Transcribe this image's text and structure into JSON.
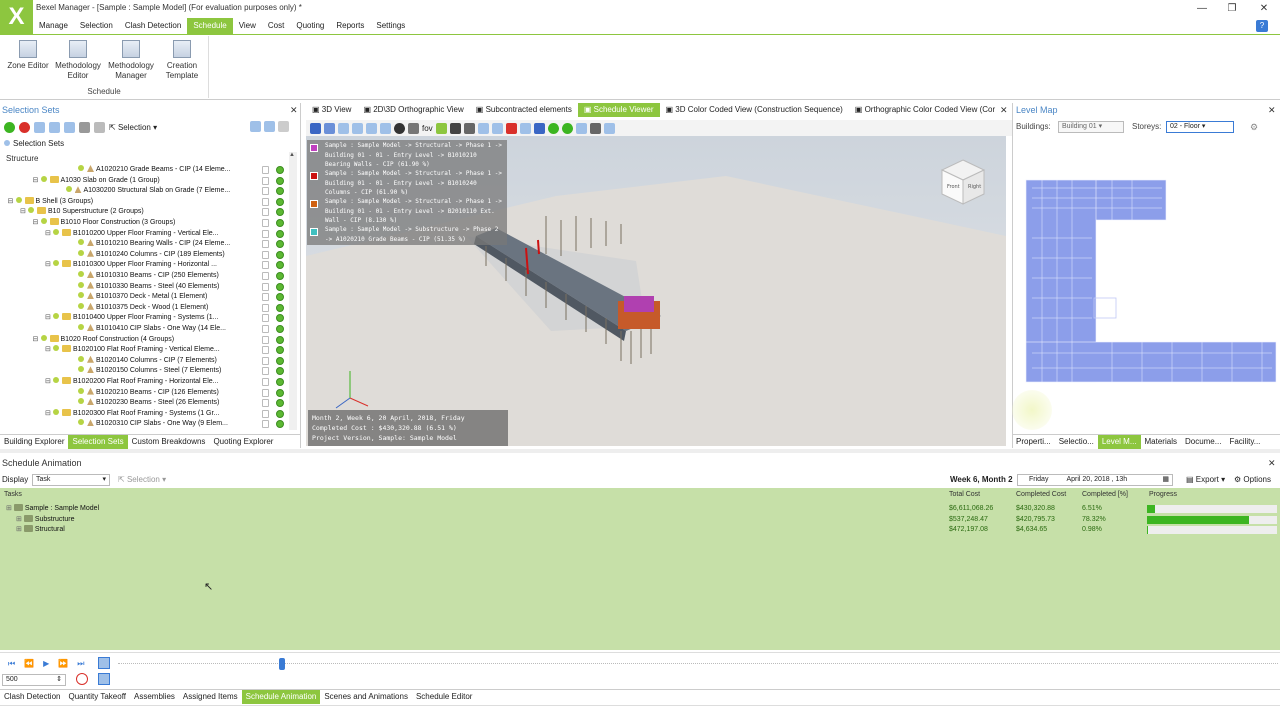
{
  "app": {
    "title": "Bexel Manager - [Sample : Sample Model] (For evaluation purposes only) *",
    "logo": "X",
    "window_buttons": [
      "—",
      "❐",
      "✕"
    ],
    "help_icon": "?"
  },
  "menu": [
    "Manage",
    "Selection",
    "Clash Detection",
    "Schedule",
    "View",
    "Cost",
    "Quoting",
    "Reports",
    "Settings"
  ],
  "menu_active": "Schedule",
  "ribbon": {
    "buttons": [
      {
        "label": "Zone Editor"
      },
      {
        "label": "Methodology Editor"
      },
      {
        "label": "Methodology Manager"
      },
      {
        "label": "Creation Template"
      }
    ],
    "group_label": "Schedule"
  },
  "selection_sets": {
    "title": "Selection Sets",
    "toolbar_selection": "Selection",
    "node_label": "Selection Sets",
    "structure_label": "Structure",
    "tree": [
      {
        "indent": 8,
        "type": "leaf",
        "text": "A1020210 Grade Beams - CIP (14 Eleme..."
      },
      {
        "indent": 5,
        "type": "folder",
        "text": "A1030 Slab on Grade (1 Group)",
        "exp": "⊟"
      },
      {
        "indent": 7,
        "type": "leaf",
        "text": "A1030200 Structural Slab on Grade (7 Eleme..."
      },
      {
        "indent": 3,
        "type": "folder",
        "text": "B Shell (3 Groups)",
        "exp": "⊟"
      },
      {
        "indent": 4,
        "type": "folder",
        "text": "B10 Superstructure (2 Groups)",
        "exp": "⊟"
      },
      {
        "indent": 5,
        "type": "folder",
        "text": "B1010 Floor Construction (3 Groups)",
        "exp": "⊟"
      },
      {
        "indent": 6,
        "type": "folder",
        "text": "B1010200 Upper Floor Framing - Vertical Ele...",
        "exp": "⊟"
      },
      {
        "indent": 8,
        "type": "leaf",
        "text": "B1010210 Bearing Walls - CIP (24 Eleme..."
      },
      {
        "indent": 8,
        "type": "leaf",
        "text": "B1010240 Columns - CIP (189 Elements)"
      },
      {
        "indent": 6,
        "type": "folder",
        "text": "B1010300 Upper Floor Framing - Horizontal ...",
        "exp": "⊟"
      },
      {
        "indent": 8,
        "type": "leaf",
        "text": "B1010310 Beams - CIP (250 Elements)"
      },
      {
        "indent": 8,
        "type": "leaf",
        "text": "B1010330 Beams - Steel (40 Elements)"
      },
      {
        "indent": 8,
        "type": "leaf",
        "text": "B1010370 Deck - Metal (1 Element)"
      },
      {
        "indent": 8,
        "type": "leaf",
        "text": "B1010375 Deck - Wood (1 Element)"
      },
      {
        "indent": 6,
        "type": "folder",
        "text": "B1010400 Upper Floor Framing - Systems (1...",
        "exp": "⊟"
      },
      {
        "indent": 8,
        "type": "leaf",
        "text": "B1010410 CIP Slabs - One Way (14 Ele..."
      },
      {
        "indent": 5,
        "type": "folder",
        "text": "B1020 Roof Construction (4 Groups)",
        "exp": "⊟"
      },
      {
        "indent": 6,
        "type": "folder",
        "text": "B1020100 Flat Roof Framing - Vertical Eleme...",
        "exp": "⊟"
      },
      {
        "indent": 8,
        "type": "leaf",
        "text": "B1020140 Columns - CIP (7 Elements)"
      },
      {
        "indent": 8,
        "type": "leaf",
        "text": "B1020150 Columns - Steel (7 Elements)"
      },
      {
        "indent": 6,
        "type": "folder",
        "text": "B1020200 Flat Roof Framing - Horizontal Ele...",
        "exp": "⊟"
      },
      {
        "indent": 8,
        "type": "leaf",
        "text": "B1020210 Beams - CIP (126 Elements)"
      },
      {
        "indent": 8,
        "type": "leaf",
        "text": "B1020230 Beams - Steel (26 Elements)"
      },
      {
        "indent": 6,
        "type": "folder",
        "text": "B1020300 Flat Roof Framing - Systems (1 Gr...",
        "exp": "⊟"
      },
      {
        "indent": 8,
        "type": "leaf",
        "text": "B1020310 CIP Slabs - One Way (9 Elem..."
      }
    ],
    "tabs": [
      "Building Explorer",
      "Selection Sets",
      "Custom Breakdowns",
      "Quoting Explorer"
    ],
    "active_tab": "Selection Sets"
  },
  "viewport": {
    "tabs": [
      "3D View",
      "2D\\3D Orthographic View",
      "Subcontracted elements",
      "Schedule Viewer",
      "3D Color Coded View (Construction Sequence)",
      "Orthographic Color Coded View (Cor"
    ],
    "active_tab": "Schedule Viewer",
    "toolbar_fov": "fov",
    "legend": [
      {
        "color": "#c040c0",
        "text": "Sample : Sample Model -> Structural -> Phase 1 -> Building 01 - 01 - Entry Level -> B1010210 Bearing Walls - CIP (61.90 %)"
      },
      {
        "color": "#cc1111",
        "text": "Sample : Sample Model -> Structural -> Phase 1 -> Building 01 - 01 - Entry Level -> B1010240 Columns - CIP (61.90 %)"
      },
      {
        "color": "#d06010",
        "text": "Sample : Sample Model -> Structural -> Phase 1 -> Building 01 - 01 - Entry Level -> B2010110 Ext. Wall - CIP (8.130 %)"
      },
      {
        "color": "#40c0c0",
        "text": "Sample : Sample Model -> Substructure -> Phase 2 -> A1020210 Grade Beams - CIP (51.35 %)"
      }
    ],
    "status_lines": [
      "Month 2, Week 6, 20 April, 2018, Friday",
      "Completed Cost : $430,320.88 (6.51 %)",
      "Project Version, Sample: Sample Model"
    ],
    "cube_labels": [
      "Front",
      "Right"
    ]
  },
  "level_map": {
    "title": "Level Map",
    "buildings_label": "Buildings:",
    "buildings_value": "Building 01",
    "storeys_label": "Storeys:",
    "storeys_value": "02 - Floor",
    "tabs": [
      "Properti...",
      "Selectio...",
      "Level M...",
      "Materials",
      "Docume...",
      "Facility..."
    ],
    "active_tab": "Level M..."
  },
  "schedule_animation": {
    "title": "Schedule Animation",
    "display_label": "Display",
    "display_value": "Task",
    "selection_label": "Selection",
    "week_label": "Week 6, Month 2",
    "day": "Friday",
    "date": "April     20, 2018 , 13h",
    "export_label": "Export",
    "options_label": "Options",
    "columns": [
      "Tasks",
      "Total Cost",
      "Completed Cost",
      "Completed [%]",
      "Progress"
    ],
    "rows": [
      {
        "name": "Sample : Sample Model",
        "total": "$6,611,068.26",
        "completed": "$430,320.88",
        "pct": "6.51%",
        "progress": 0.065,
        "indent": 0
      },
      {
        "name": "Substructure",
        "total": "$537,248.47",
        "completed": "$420,795.73",
        "pct": "78.32%",
        "progress": 0.7832,
        "indent": 1
      },
      {
        "name": "Structural",
        "total": "$472,197.08",
        "completed": "$4,634.65",
        "pct": "0.98%",
        "progress": 0.0098,
        "indent": 1
      }
    ],
    "speed_value": "500",
    "timeline_position": 0.217
  },
  "bottom_tabs": [
    "Clash Detection",
    "Quantity Takeoff",
    "Assemblies",
    "Assigned Items",
    "Schedule Animation",
    "Scenes and Animations",
    "Schedule Editor"
  ],
  "bottom_active": "Schedule Animation",
  "colors": {
    "accent": "#8dc63f",
    "grid_bg": "#c6e0a8",
    "progress": "#3cb521",
    "panel_title": "#4a86c5"
  }
}
